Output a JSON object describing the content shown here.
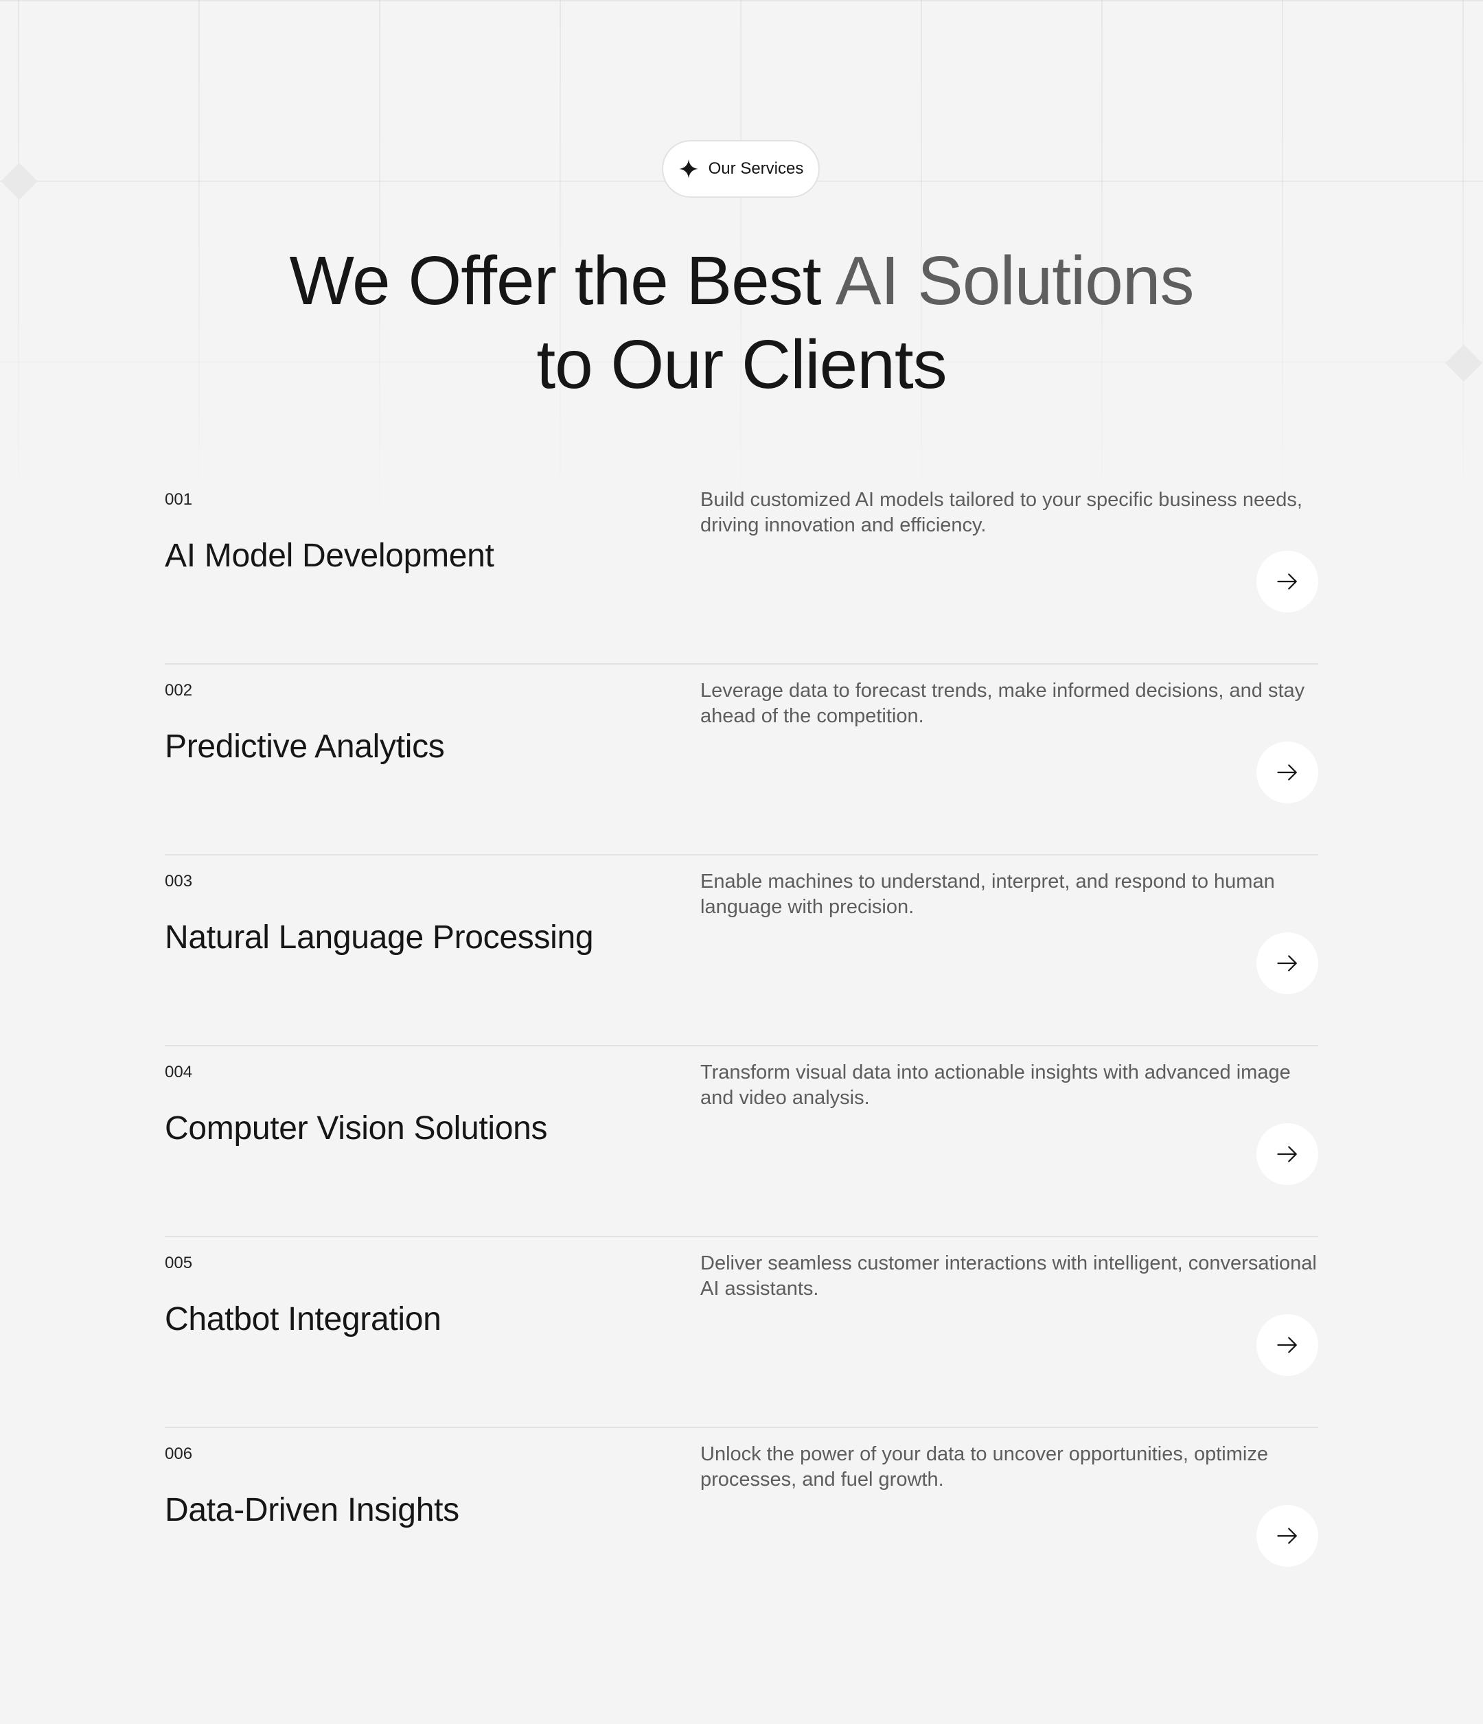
{
  "badge": {
    "label": "Our Services",
    "icon": "sparkle-icon"
  },
  "heading": {
    "line1_main": "We Offer the Best ",
    "line1_accent": "AI Solutions",
    "line2": "to Our Clients"
  },
  "colors": {
    "background": "#f4f4f4",
    "text": "#161616",
    "accent_text": "#5e5e5e",
    "description": "#5d5d5d",
    "divider": "#e2e2e2",
    "button": "#ffffff"
  },
  "services": [
    {
      "number": "001",
      "title": "AI Model Development",
      "description": "Build customized AI models tailored to your specific business needs, driving innovation and efficiency.",
      "icon": "arrow-right-icon"
    },
    {
      "number": "002",
      "title": "Predictive Analytics",
      "description": "Leverage data to forecast trends, make informed decisions, and stay ahead of the competition.",
      "icon": "arrow-right-icon"
    },
    {
      "number": "003",
      "title": "Natural Language Processing",
      "description": "Enable machines to understand, interpret, and respond to human language with precision.",
      "icon": "arrow-right-icon"
    },
    {
      "number": "004",
      "title": "Computer Vision Solutions",
      "description": "Transform visual data into actionable insights with advanced image and video analysis.",
      "icon": "arrow-right-icon"
    },
    {
      "number": "005",
      "title": "Chatbot Integration",
      "description": "Deliver seamless customer interactions with intelligent, conversational AI assistants.",
      "icon": "arrow-right-icon"
    },
    {
      "number": "006",
      "title": "Data-Driven Insights",
      "description": "Unlock the power of your data to uncover opportunities, optimize processes, and fuel growth.",
      "icon": "arrow-right-icon"
    }
  ]
}
